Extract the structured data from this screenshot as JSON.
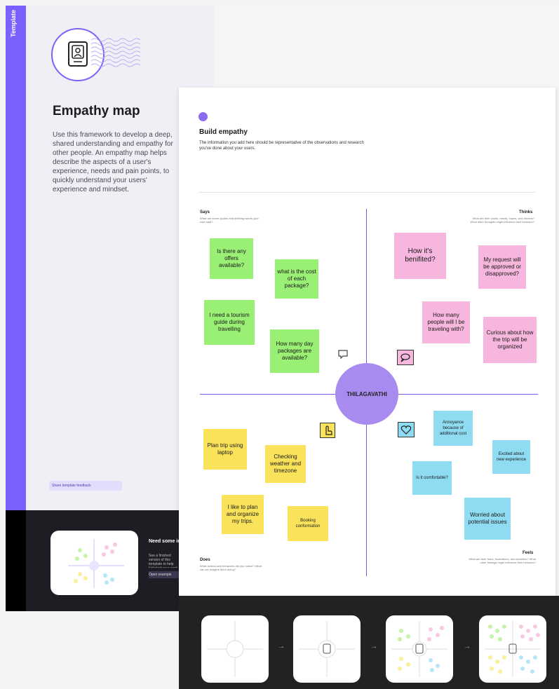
{
  "left": {
    "tag": "Template",
    "title": "Empathy map",
    "description": "Use this framework to develop a deep, shared understanding and empathy for other people. An empathy map helps describe the aspects of a user's experience, needs and pain points, to quickly understand your users' experience and mindset.",
    "share_link": "Share template feedback"
  },
  "promo": {
    "title": "Need some inspiration?",
    "body": "See a finished version of this template to help kickstart your work.",
    "button": "Open example"
  },
  "card": {
    "title": "Build empathy",
    "description": "The information you add here should be representative of the observations and research you've done about your users.",
    "persona": "THILAGAVATHI"
  },
  "quadrants": {
    "says": {
      "label": "Says",
      "sub": "What are some quotes and defining words your user said?"
    },
    "thinks": {
      "label": "Thinks",
      "sub": "What are their wants, needs, hopes, and dreams? What other thoughts might influence their behavior?"
    },
    "does": {
      "label": "Does",
      "sub": "What actions and behaviors did you notice? What can we imagine them doing?"
    },
    "feels": {
      "label": "Feels",
      "sub": "What are their fears, frustrations, and anxieties? What other feelings might influence their behavior?"
    }
  },
  "notes": {
    "says": [
      "Is there any offers available?",
      "what is the cost of each package?",
      "I need a tourism guide during travelling",
      "How many day packages are available?"
    ],
    "thinks": [
      "How it's benifited?",
      "My request will be approved or disapproved?",
      "How many people will I be traveling with?",
      "Curious about how the trip will be organized"
    ],
    "does": [
      "Plan trip using laptop",
      "Checking weather and timezone",
      "I like to plan and organize my trips.",
      "Booking conformation"
    ],
    "feels": [
      "Annoyance because of additional cost",
      "Excited about new experience",
      "Is it comfortable?",
      "Worried about potential issues"
    ]
  },
  "icons": {
    "says": "speech-bubble-icon",
    "thinks": "thought-bubble-icon",
    "does": "hand-pointer-icon",
    "feels": "heart-icon"
  },
  "colors": {
    "accent": "#7b61ff",
    "says_note": "#9aef75",
    "thinks_note": "#f7b6dd",
    "does_note": "#fae35a",
    "feels_note": "#8fdcf2"
  }
}
